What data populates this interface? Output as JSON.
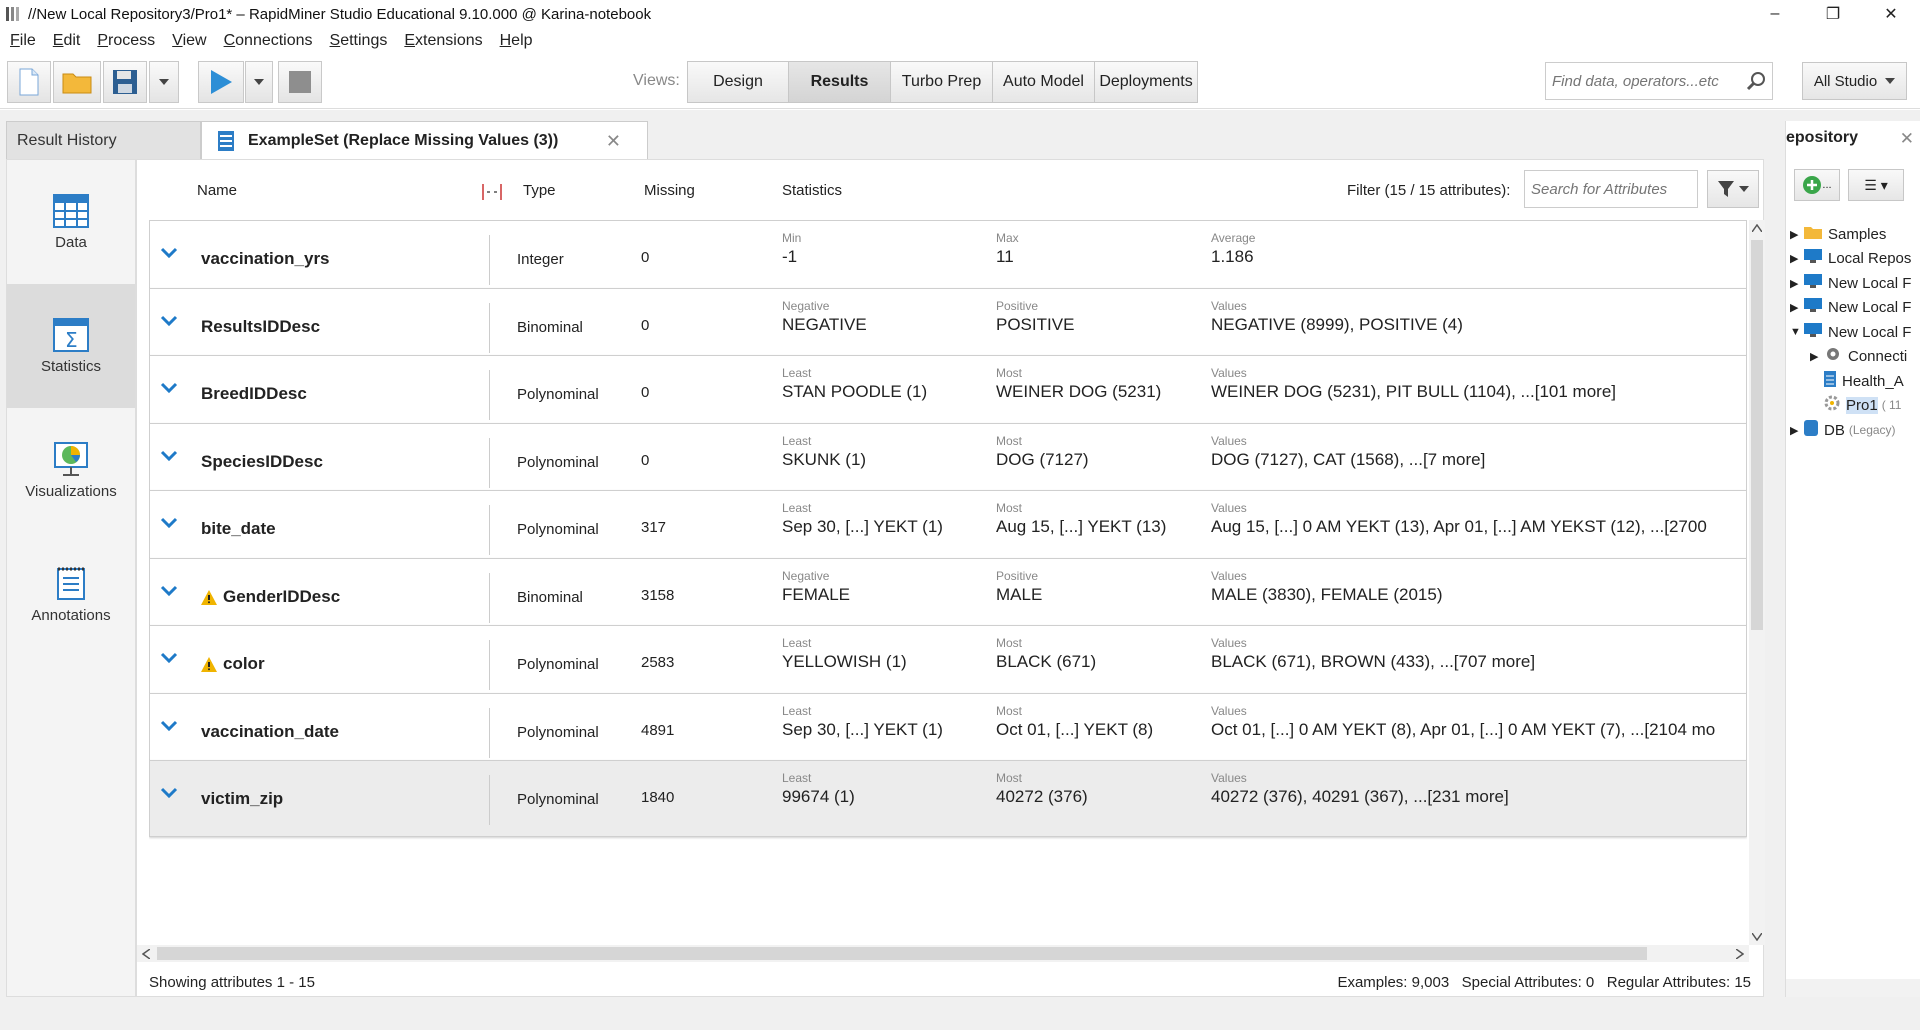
{
  "window": {
    "title": "//New Local Repository3/Pro1* – RapidMiner Studio Educational 9.10.000 @ Karina-notebook",
    "minimize": "–",
    "maximize": "❐",
    "close": "✕"
  },
  "menu": [
    "File",
    "Edit",
    "Process",
    "View",
    "Connections",
    "Settings",
    "Extensions",
    "Help"
  ],
  "toolbar": {
    "views_label": "Views:",
    "views": [
      "Design",
      "Results",
      "Turbo Prep",
      "Auto Model",
      "Deployments"
    ],
    "active_view": "Results",
    "search_placeholder": "Find data, operators...etc",
    "scope": "All Studio"
  },
  "tabs": {
    "history": "Result History",
    "example": "ExampleSet (Replace Missing Values (3))"
  },
  "sidebar": {
    "items": [
      {
        "label": "Data",
        "icon": "table-icon"
      },
      {
        "label": "Statistics",
        "icon": "statistics-icon"
      },
      {
        "label": "Visualizations",
        "icon": "visualizations-icon"
      },
      {
        "label": "Annotations",
        "icon": "annotations-icon"
      }
    ],
    "active": "Statistics"
  },
  "columns": {
    "name": "Name",
    "type": "Type",
    "missing": "Missing",
    "statistics": "Statistics",
    "filter": "Filter (15 / 15 attributes):",
    "filter_placeholder": "Search for Attributes"
  },
  "rows": [
    {
      "name": "vaccination_yrs",
      "warn": false,
      "type": "Integer",
      "missing": "0",
      "l1": "Min",
      "v1": "-1",
      "l2": "Max",
      "v2": "11",
      "l3": "Average",
      "v3": "1.186"
    },
    {
      "name": "ResultsIDDesc",
      "warn": false,
      "type": "Binominal",
      "missing": "0",
      "l1": "Negative",
      "v1": "NEGATIVE",
      "l2": "Positive",
      "v2": "POSITIVE",
      "l3": "Values",
      "v3": "NEGATIVE (8999), POSITIVE (4)"
    },
    {
      "name": "BreedIDDesc",
      "warn": false,
      "type": "Polynominal",
      "missing": "0",
      "l1": "Least",
      "v1": "STAN POODLE (1)",
      "l2": "Most",
      "v2": "WEINER DOG (5231)",
      "l3": "Values",
      "v3": "WEINER DOG (5231), PIT BULL (1104), ...[101 more]"
    },
    {
      "name": "SpeciesIDDesc",
      "warn": false,
      "type": "Polynominal",
      "missing": "0",
      "l1": "Least",
      "v1": "SKUNK (1)",
      "l2": "Most",
      "v2": "DOG (7127)",
      "l3": "Values",
      "v3": "DOG (7127), CAT (1568), ...[7 more]"
    },
    {
      "name": "bite_date",
      "warn": false,
      "type": "Polynominal",
      "missing": "317",
      "l1": "Least",
      "v1": "Sep 30,  [...]  YEKT (1)",
      "l2": "Most",
      "v2": "Aug 15,  [...] YEKT (13)",
      "l3": "Values",
      "v3": "Aug 15,  [...] 0 AM YEKT (13), Apr 01,  [...]  AM YEKST (12), ...[2700"
    },
    {
      "name": "GenderIDDesc",
      "warn": true,
      "type": "Binominal",
      "missing": "3158",
      "l1": "Negative",
      "v1": "FEMALE",
      "l2": "Positive",
      "v2": "MALE",
      "l3": "Values",
      "v3": "MALE (3830), FEMALE (2015)"
    },
    {
      "name": "color",
      "warn": true,
      "type": "Polynominal",
      "missing": "2583",
      "l1": "Least",
      "v1": "YELLOWISH (1)",
      "l2": "Most",
      "v2": "BLACK (671)",
      "l3": "Values",
      "v3": "BLACK (671), BROWN (433), ...[707 more]"
    },
    {
      "name": "vaccination_date",
      "warn": false,
      "type": "Polynominal",
      "missing": "4891",
      "l1": "Least",
      "v1": "Sep 30,  [...]  YEKT (1)",
      "l2": "Most",
      "v2": "Oct 01,  [...]  YEKT (8)",
      "l3": "Values",
      "v3": "Oct 01,  [...] 0 AM YEKT (8), Apr 01,  [...] 0 AM YEKT (7), ...[2104 mo"
    },
    {
      "name": "victim_zip",
      "warn": false,
      "type": "Polynominal",
      "missing": "1840",
      "l1": "Least",
      "v1": "99674 (1)",
      "l2": "Most",
      "v2": "40272 (376)",
      "l3": "Values",
      "v3": "40272 (376), 40291 (367), ...[231 more]"
    }
  ],
  "status": {
    "showing": "Showing attributes 1 - 15",
    "summary": "Examples: 9,003   Special Attributes: 0   Regular Attributes: 15"
  },
  "repository": {
    "title": "epository",
    "add_label": "...",
    "menu_label": "☰ ▾",
    "tree": [
      {
        "label": "Samples",
        "icon": "folder-icon",
        "muted": ""
      },
      {
        "label": "Local Repos",
        "icon": "repository-icon",
        "muted": ""
      },
      {
        "label": "New Local F",
        "icon": "repository-icon",
        "muted": ""
      },
      {
        "label": "New Local F",
        "icon": "repository-icon",
        "muted": ""
      },
      {
        "label": "New Local F",
        "icon": "repository-icon",
        "muted": ""
      },
      {
        "label": "Connecti",
        "icon": "connection-icon",
        "muted": ""
      },
      {
        "label": "Health_A",
        "icon": "data-icon",
        "muted": ""
      },
      {
        "label": "Pro1",
        "icon": "process-icon",
        "muted": "( 11"
      },
      {
        "label": "DB",
        "icon": "database-icon",
        "muted": "(Legacy)"
      }
    ]
  },
  "colors": {
    "accent_blue": "#1e7ac8",
    "warning": "#f0b400"
  }
}
